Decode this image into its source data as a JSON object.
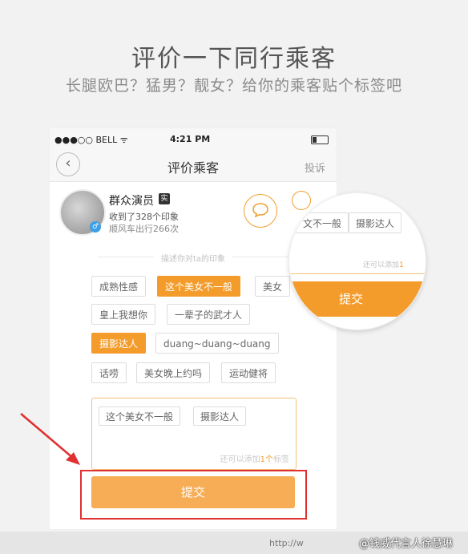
{
  "hero": {
    "title": "评价一下同行乘客",
    "subtitle": "长腿欧巴？猛男？靓女？给你的乘客贴个标签吧"
  },
  "status_bar": {
    "carrier": "●●●○○ BELL ᯤ",
    "time": "4:21 PM"
  },
  "nav": {
    "back_icon": "‹",
    "title": "评价乘客",
    "report": "投诉"
  },
  "user": {
    "name": "群众演员",
    "verified_badge": "实",
    "impressions": "收到了328个印象",
    "rides": "顺风车出行266次",
    "gender_icon": "♂"
  },
  "section_caption": "描述你对ta的印象",
  "tags": [
    {
      "label": "成熟性感",
      "selected": false
    },
    {
      "label": "这个美女不一般",
      "selected": true
    },
    {
      "label": "美女",
      "selected": false
    },
    {
      "label": "皇上我想你",
      "selected": false
    },
    {
      "label": "一辈子的武才人",
      "selected": false
    },
    {
      "label": "摄影达人",
      "selected": true
    },
    {
      "label": "duang~duang~duang",
      "selected": false
    },
    {
      "label": "话唠",
      "selected": false
    },
    {
      "label": "美女晚上约吗",
      "selected": false
    },
    {
      "label": "运动健将",
      "selected": false
    }
  ],
  "selected_box": {
    "chosen": [
      "这个美女不一般",
      "摄影达人"
    ],
    "hint_prefix": "还可以添加",
    "hint_count": "1个",
    "hint_suffix": "标签"
  },
  "submit_label": "提交",
  "zoom": {
    "tags": [
      "文不一般",
      "摄影达人"
    ],
    "hint_prefix": "还可以添加",
    "hint_count": "1",
    "submit_label": "提交"
  },
  "footer": {
    "url": "http://w",
    "handle": "@钱威代言人徐慧琳"
  },
  "colors": {
    "accent": "#f39c2b",
    "submit_bg": "#f6ad55",
    "highlight_red": "#e03030"
  }
}
